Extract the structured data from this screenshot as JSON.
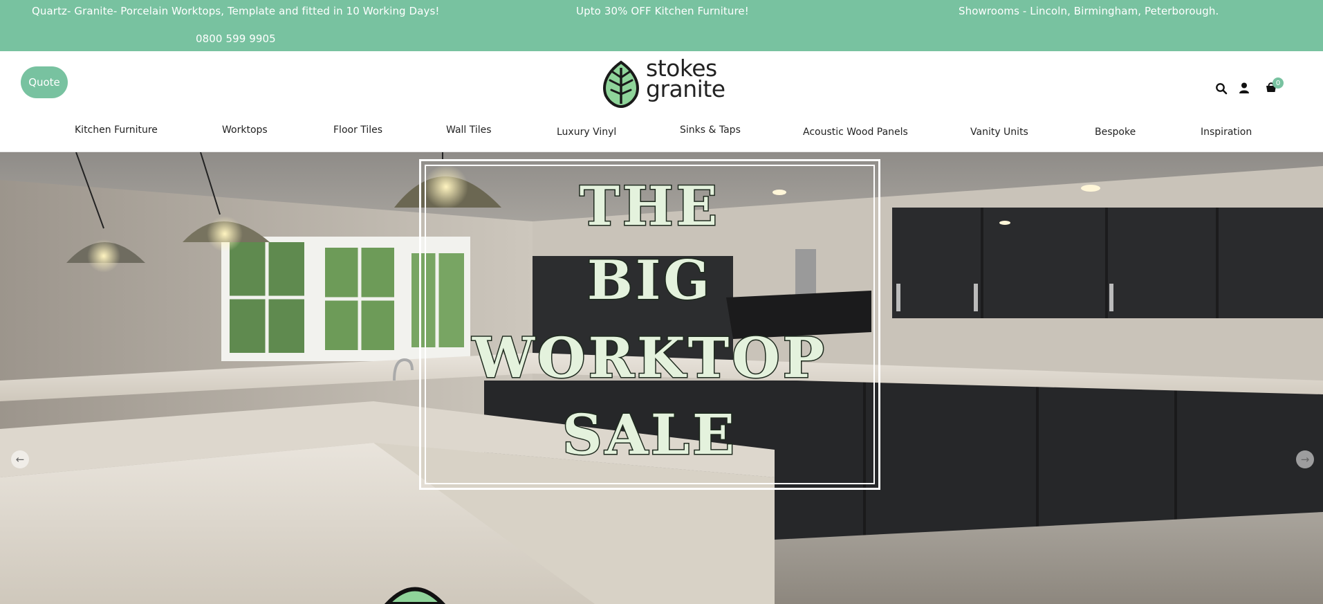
{
  "announcement": {
    "message_1": "Quartz- Granite- Porcelain Worktops, Template and fitted in 10 Working Days!",
    "message_2": "Upto 30% OFF Kitchen Furniture!",
    "message_3": "Showrooms - Lincoln, Birmingham, Peterborough.",
    "phone": "0800 599 9905"
  },
  "header": {
    "quote_label": "Quote",
    "brand_line_1": "stokes",
    "brand_line_2": "granite",
    "cart_count": "0",
    "icons": [
      "search-icon",
      "account-icon",
      "cart-icon",
      "leaf-logo-icon"
    ]
  },
  "nav": {
    "items": [
      {
        "label": "Kitchen Furniture"
      },
      {
        "label": "Worktops"
      },
      {
        "label": "Floor Tiles"
      },
      {
        "label": "Wall Tiles"
      },
      {
        "label": "Luxury Vinyl"
      },
      {
        "label": "Sinks & Taps"
      },
      {
        "label": "Acoustic Wood Panels"
      },
      {
        "label": "Vanity Units"
      },
      {
        "label": "Bespoke"
      },
      {
        "label": "Inspiration"
      }
    ]
  },
  "hero": {
    "line_1": "THE",
    "line_2": "BIG",
    "line_3": "WORKTOP",
    "line_4": "SALE",
    "prev_label": "←",
    "next_label": "→"
  },
  "colors": {
    "accent": "#78c2a0",
    "sale_text": "#e4f2dd",
    "sale_outline": "#1e2a1e"
  }
}
